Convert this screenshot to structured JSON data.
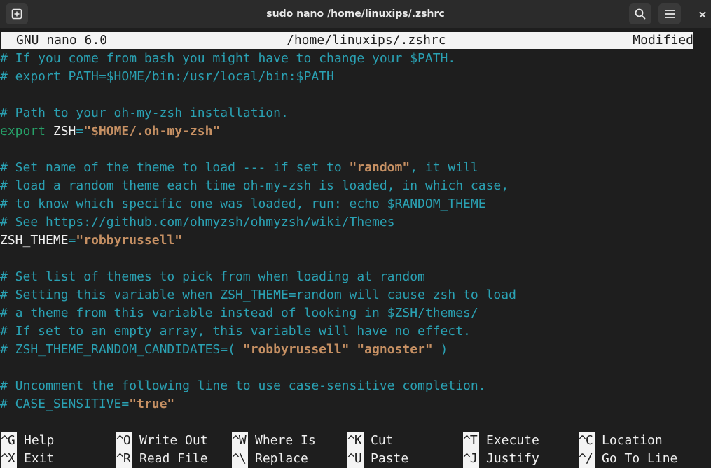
{
  "window": {
    "title": "sudo nano /home/linuxips/.zshrc"
  },
  "nano": {
    "version": "GNU nano 6.0",
    "file": "/home/linuxips/.zshrc",
    "status": "Modified"
  },
  "lines": [
    [
      {
        "t": "# If you come from bash you might have to change your $PATH.",
        "c": "comment"
      }
    ],
    [
      {
        "t": "# export PATH=$HOME/bin:/usr/local/bin:$PATH",
        "c": "comment"
      }
    ],
    [],
    [
      {
        "t": "# Path to your oh-my-zsh installation.",
        "c": "comment"
      }
    ],
    [
      {
        "t": "export",
        "c": "keyword"
      },
      {
        "t": " ZSH",
        "c": "plain"
      },
      {
        "t": "=",
        "c": "op"
      },
      {
        "t": "\"$HOME/.oh-my-zsh\"",
        "c": "string"
      }
    ],
    [],
    [
      {
        "t": "# Set name of the theme to load --- if set to ",
        "c": "comment"
      },
      {
        "t": "\"random\"",
        "c": "string"
      },
      {
        "t": ", it will",
        "c": "comment"
      }
    ],
    [
      {
        "t": "# load a random theme each time oh-my-zsh is loaded, in which case,",
        "c": "comment"
      }
    ],
    [
      {
        "t": "# to know which specific one was loaded, run: echo $RANDOM_THEME",
        "c": "comment"
      }
    ],
    [
      {
        "t": "# See https://github.com/ohmyzsh/ohmyzsh/wiki/Themes",
        "c": "comment"
      }
    ],
    [
      {
        "t": "ZSH_THEME",
        "c": "plain"
      },
      {
        "t": "=",
        "c": "op"
      },
      {
        "t": "\"robbyrussell\"",
        "c": "string"
      }
    ],
    [],
    [
      {
        "t": "# Set list of themes to pick from when loading at random",
        "c": "comment"
      }
    ],
    [
      {
        "t": "# Setting this variable when ZSH_THEME=random will cause zsh to load",
        "c": "comment"
      }
    ],
    [
      {
        "t": "# a theme from this variable instead of looking in $ZSH/themes/",
        "c": "comment"
      }
    ],
    [
      {
        "t": "# If set to an empty array, this variable will have no effect.",
        "c": "comment"
      }
    ],
    [
      {
        "t": "# ZSH_THEME_RANDOM_CANDIDATES=( ",
        "c": "comment"
      },
      {
        "t": "\"robbyrussell\"",
        "c": "string"
      },
      {
        "t": " ",
        "c": "comment"
      },
      {
        "t": "\"agnoster\"",
        "c": "string"
      },
      {
        "t": " )",
        "c": "comment"
      }
    ],
    [],
    [
      {
        "t": "# Uncomment the following line to use case-sensitive completion.",
        "c": "comment"
      }
    ],
    [
      {
        "t": "# CASE_SENSITIVE=",
        "c": "comment"
      },
      {
        "t": "\"true\"",
        "c": "string"
      }
    ]
  ],
  "shortcuts": [
    {
      "key": "^G",
      "label": "Help"
    },
    {
      "key": "^O",
      "label": "Write Out"
    },
    {
      "key": "^W",
      "label": "Where Is"
    },
    {
      "key": "^K",
      "label": "Cut"
    },
    {
      "key": "^T",
      "label": "Execute"
    },
    {
      "key": "^C",
      "label": "Location"
    },
    {
      "key": "^X",
      "label": "Exit"
    },
    {
      "key": "^R",
      "label": "Read File"
    },
    {
      "key": "^\\",
      "label": "Replace"
    },
    {
      "key": "^U",
      "label": "Paste"
    },
    {
      "key": "^J",
      "label": "Justify"
    },
    {
      "key": "^/",
      "label": "Go To Line"
    }
  ],
  "icons": {
    "new_tab": "new-tab-icon",
    "search": "search-icon",
    "menu": "hamburger-menu-icon",
    "close": "close-icon"
  },
  "colors": {
    "comment": "#2aa1b3",
    "keyword": "#26a269",
    "string": "#c69063",
    "background": "#1e1e1e",
    "titlebar": "#2b2b2b"
  }
}
